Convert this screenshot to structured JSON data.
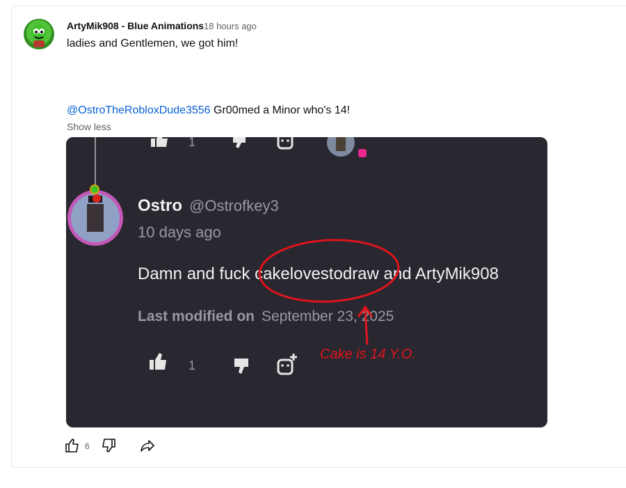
{
  "comment": {
    "author": "ArtyMik908 - Blue Animations",
    "time": "18 hours ago",
    "line1": "ladies and Gentlemen, we got him!",
    "mention": "@OstroTheRobloxDude3556",
    "line2_rest": " Gr00med a Minor who's 14!",
    "show_less": "Show less",
    "like_count": "6"
  },
  "screenshot": {
    "top_like_count": "1",
    "name": "Ostro",
    "handle": "@Ostrofkey3",
    "time": "10 days ago",
    "message": "Damn and fuck cakelovestodraw and ArtyMik908",
    "modified_label": "Last modified on",
    "modified_date": "September 23, 2025",
    "like_count": "1",
    "annotation": "Cake is 14 Y.O.",
    "annotation_color": "#e0141c"
  },
  "icons": [
    "avatar",
    "thumbs-up-icon",
    "thumbs-down-icon",
    "share-icon",
    "sticker-icon"
  ]
}
